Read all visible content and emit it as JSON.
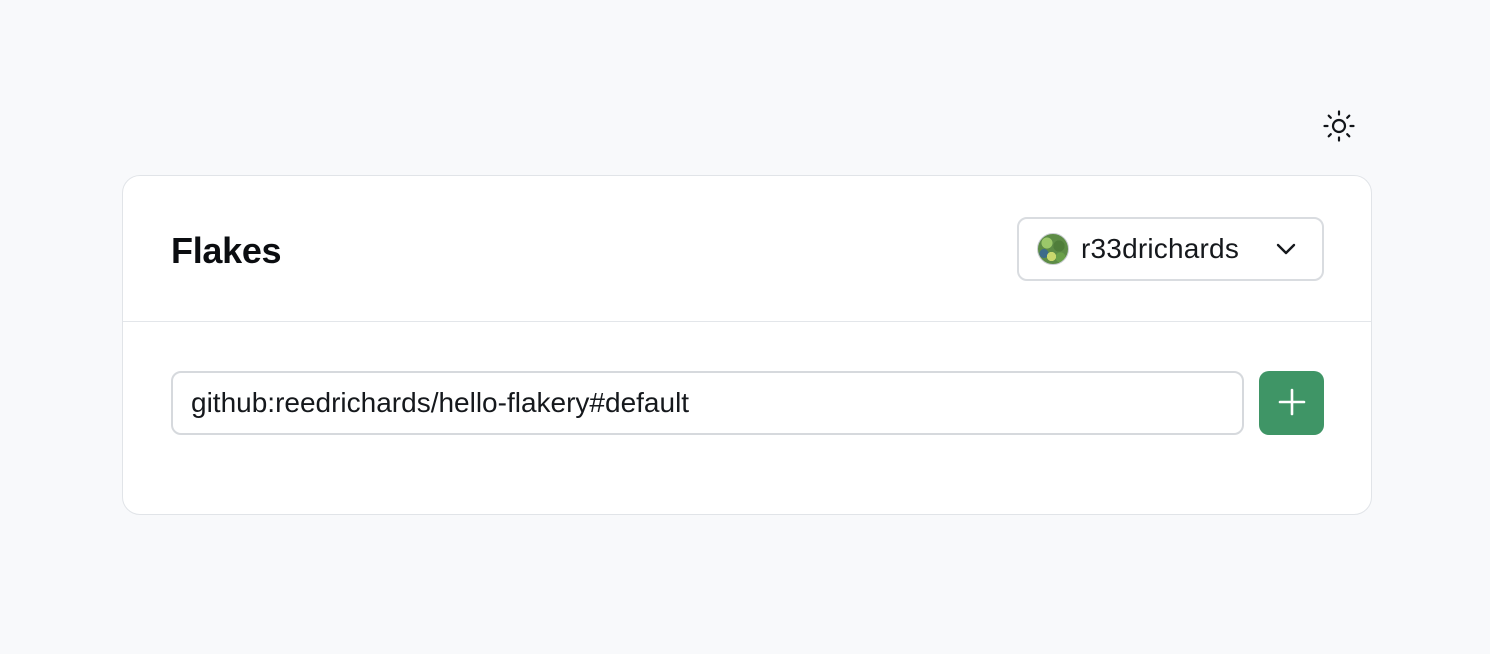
{
  "theme_toggle": {
    "icon": "sun-icon"
  },
  "card": {
    "title": "Flakes",
    "user_select": {
      "username": "r33drichards",
      "avatar_icon": "avatar",
      "dropdown_icon": "chevron-down-icon"
    },
    "flake_input": {
      "value": "github:reedrichards/hello-flakery#default"
    },
    "add_button": {
      "icon": "plus-icon",
      "color": "#3f9566"
    }
  }
}
